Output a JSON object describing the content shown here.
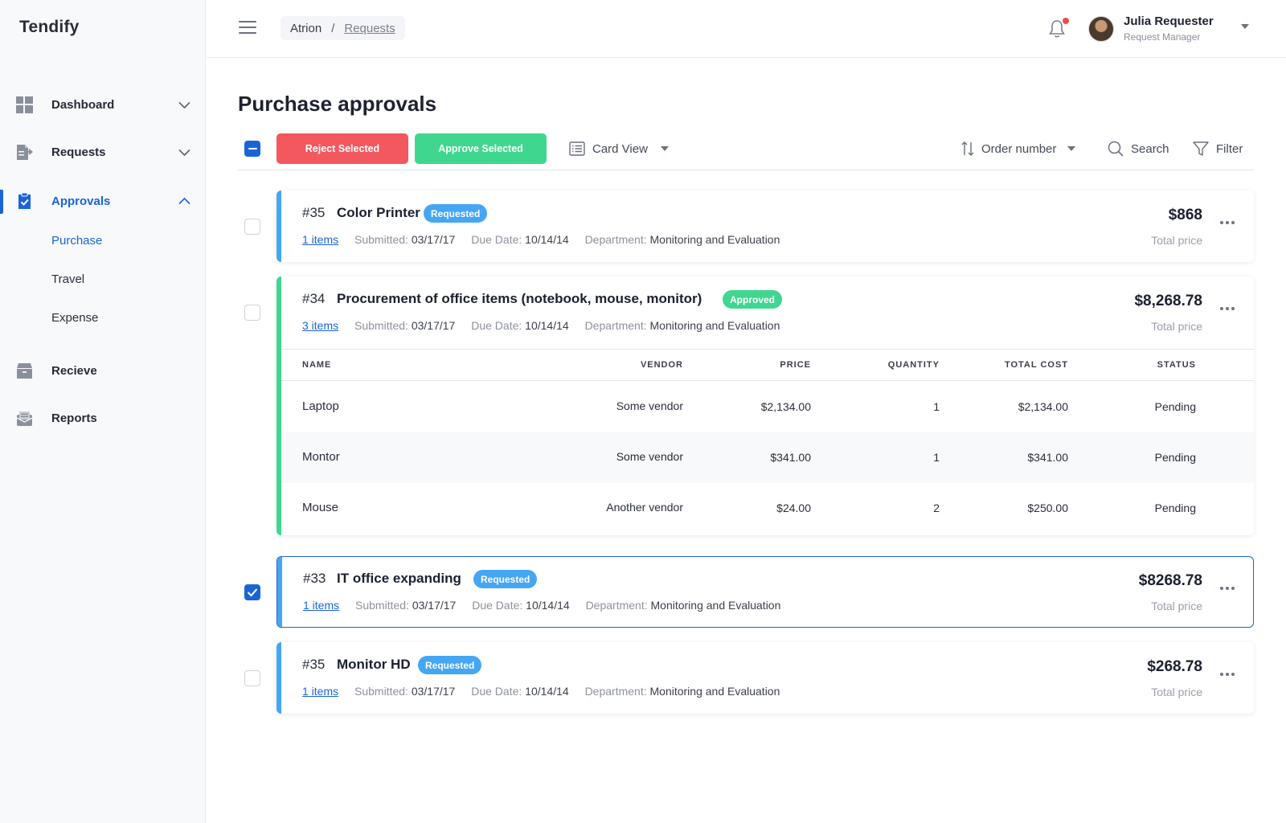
{
  "app": {
    "name": "Tendify"
  },
  "sidebar": {
    "items": [
      {
        "label": "Dashboard",
        "icon": "dashboard-icon",
        "expanded": false
      },
      {
        "label": "Requests",
        "icon": "requests-icon",
        "expanded": false
      },
      {
        "label": "Approvals",
        "icon": "approvals-icon",
        "expanded": true,
        "active": true
      },
      {
        "label": "Recieve",
        "icon": "box-icon"
      },
      {
        "label": "Reports",
        "icon": "reports-icon"
      }
    ],
    "subitems": [
      {
        "label": "Purchase",
        "active": true
      },
      {
        "label": "Travel"
      },
      {
        "label": "Expense"
      }
    ]
  },
  "header": {
    "breadcrumb": {
      "root": "Atrion",
      "separator": "/",
      "current": "Requests"
    },
    "notifications": {
      "has_unread": true
    },
    "user": {
      "name": "Julia Requester",
      "role": "Request Manager"
    }
  },
  "main": {
    "title": "Purchase approvals",
    "toolbar": {
      "reject_label": "Reject Selected",
      "approve_label": "Approve Selected",
      "view_label": "Card View",
      "sort_label": "Order number",
      "search_label": "Search",
      "filter_label": "Filter"
    },
    "price_label": "Total price",
    "meta_labels": {
      "submitted": "Submitted:",
      "due": "Due Date:",
      "department": "Department:"
    },
    "requests": [
      {
        "number": "#35",
        "title": "Color Printer",
        "status": "Requested",
        "items": "1 items",
        "submitted": "03/17/17",
        "due": "10/14/14",
        "department": "Monitoring and Evaluation",
        "price": "$868",
        "checked": false
      },
      {
        "number": "#34",
        "title": "Procurement of office items (notebook, mouse, monitor)",
        "status": "Approved",
        "items": "3 items",
        "submitted": "03/17/17",
        "due": "10/14/14",
        "department": "Monitoring and Evaluation",
        "price": "$8,268.78",
        "checked": false,
        "expanded": true
      },
      {
        "number": "#33",
        "title": "IT office expanding",
        "status": "Requested",
        "items": "1 items",
        "submitted": "03/17/17",
        "due": "10/14/14",
        "department": "Monitoring and Evaluation",
        "price": "$8268.78",
        "checked": true
      },
      {
        "number": "#35",
        "title": "Monitor HD",
        "status": "Requested",
        "items": "1 items",
        "submitted": "03/17/17",
        "due": "10/14/14",
        "department": "Monitoring and Evaluation",
        "price": "$268.78",
        "checked": false
      }
    ],
    "line_items": {
      "columns": [
        "NAME",
        "VENDOR",
        "PRICE",
        "QUANTITY",
        "TOTAL COST",
        "STATUS"
      ],
      "rows": [
        {
          "name": "Laptop",
          "vendor": "Some vendor",
          "price": "$2,134.00",
          "quantity": "1",
          "total": "$2,134.00",
          "status": "Pending"
        },
        {
          "name": "Montor",
          "vendor": "Some vendor",
          "price": "$341.00",
          "quantity": "1",
          "total": "$341.00",
          "status": "Pending"
        },
        {
          "name": "Mouse",
          "vendor": "Another vendor",
          "price": "$24.00",
          "quantity": "2",
          "total": "$250.00",
          "status": "Pending"
        }
      ]
    }
  },
  "colors": {
    "primary": "#1a64d8",
    "requested": "#45a6f3",
    "approved": "#3fd78f",
    "reject": "#f2585e"
  }
}
